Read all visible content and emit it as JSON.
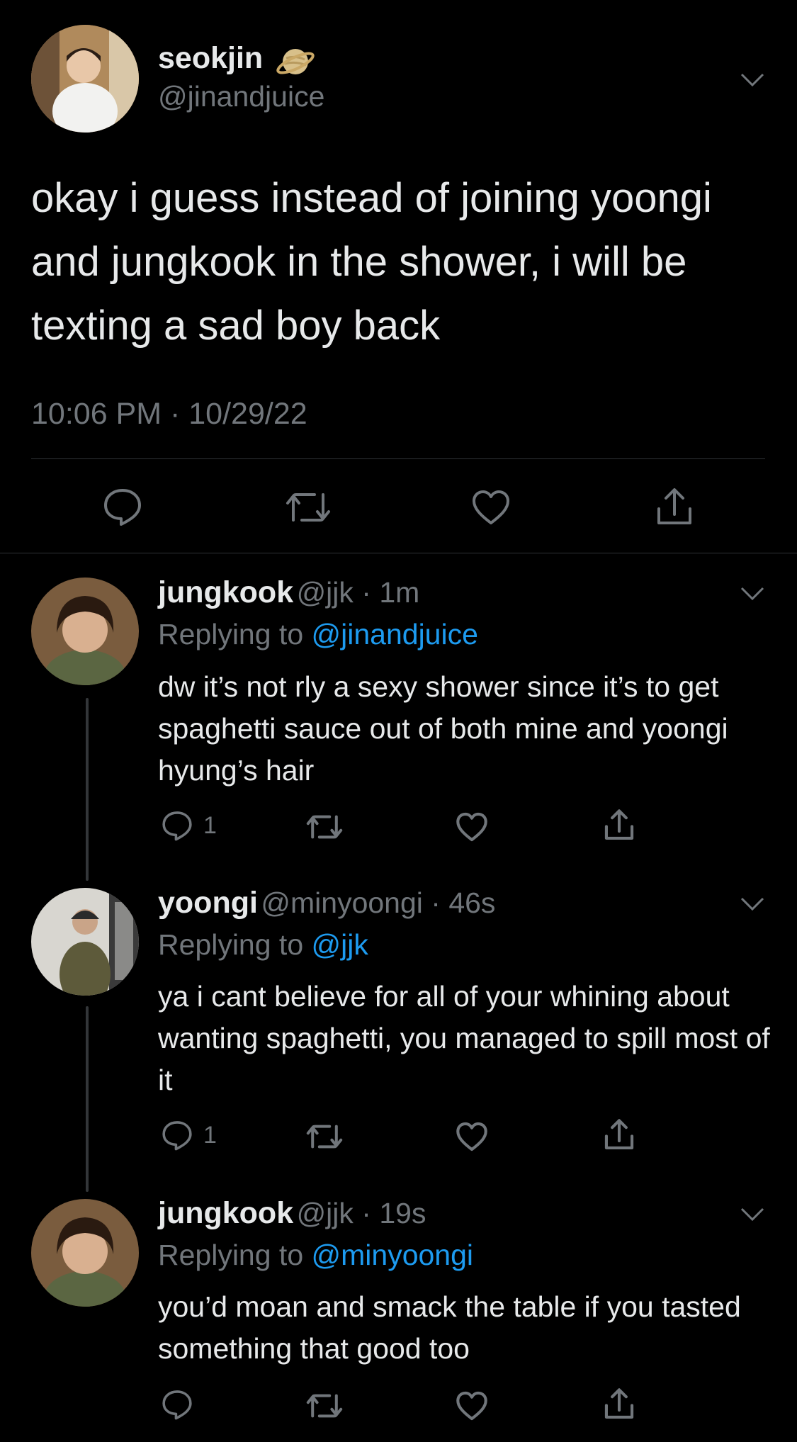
{
  "main_tweet": {
    "name": "seokjin",
    "handle": "@jinandjuice",
    "emoji_icon": "ringed-planet-icon",
    "text": "okay i guess instead of joining yoongi and jungkook in the shower, i will be texting a sad boy back",
    "timestamp": "10:06 PM · 10/29/22",
    "actions": [
      "reply-icon",
      "retweet-icon",
      "like-icon",
      "share-icon"
    ]
  },
  "replies": [
    {
      "name": "jungkook",
      "meta": "@jjk · 1m",
      "replying_prefix": "Replying to ",
      "replying_to": "@jinandjuice",
      "text": "dw it’s not rly a sexy shower since it’s to get spaghetti sauce out of both mine and yoongi hyung’s hair",
      "reply_count": "1"
    },
    {
      "name": "yoongi",
      "meta": "@minyoongi · 46s",
      "replying_prefix": "Replying to ",
      "replying_to": "@jjk",
      "text": "ya i cant believe for all of your whining about wanting spaghetti, you managed to spill most of it",
      "reply_count": "1"
    },
    {
      "name": "jungkook",
      "meta": "@jjk · 19s",
      "replying_prefix": "Replying to ",
      "replying_to": "@minyoongi",
      "text": "you’d moan and smack the table if you tasted something that good too",
      "reply_count": ""
    }
  ],
  "colors": {
    "background": "#000000",
    "primary_text": "#e7e9ea",
    "secondary_text": "#71767b",
    "link": "#1d9bf0",
    "divider": "#2f3336"
  }
}
